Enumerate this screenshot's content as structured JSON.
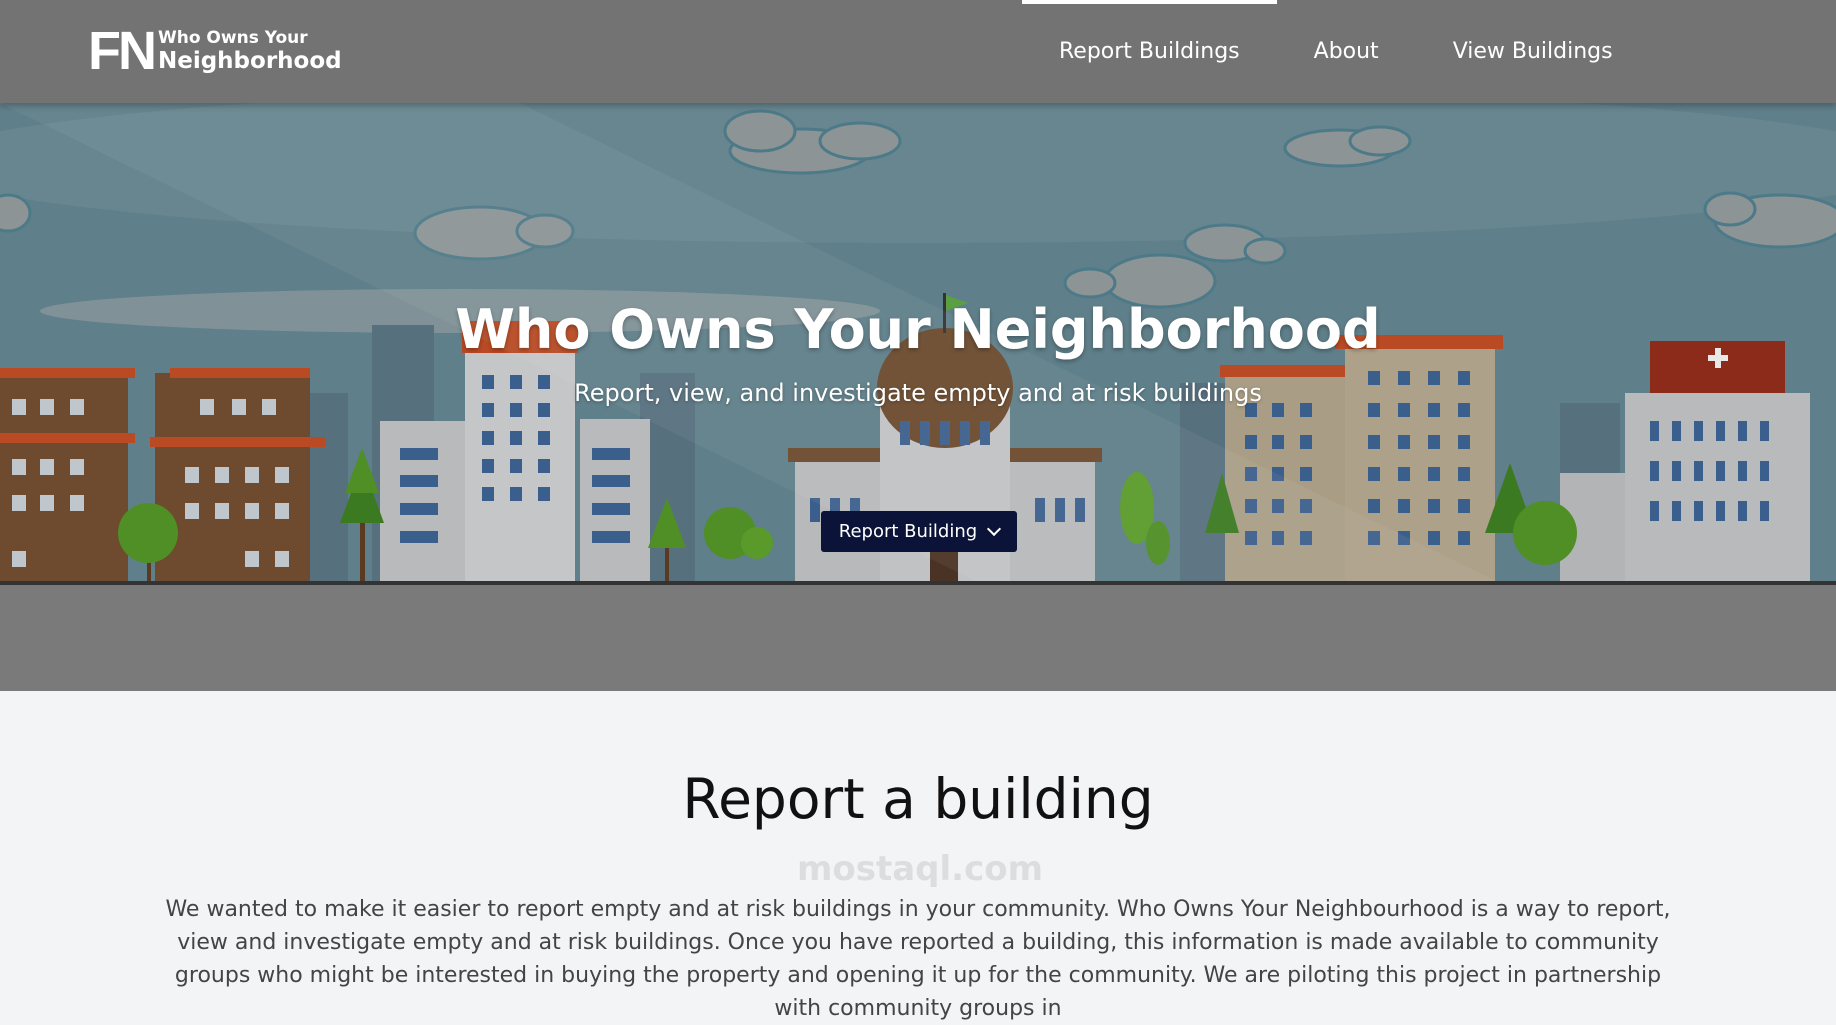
{
  "brand": {
    "mark": "FN",
    "line1": "Who Owns Your",
    "line2": "Neighborhood"
  },
  "nav": {
    "items": [
      {
        "label": "Report Buildings",
        "active": true
      },
      {
        "label": "About",
        "active": false
      },
      {
        "label": "View Buildings",
        "active": false
      }
    ]
  },
  "hero": {
    "title": "Who Owns Your Neighborhood",
    "subtitle": "Report, view, and investigate empty and at risk buildings",
    "button_label": "Report Building"
  },
  "section": {
    "title": "Report a building",
    "body": "We wanted to make it easier to report empty and at risk buildings in your community. Who Owns Your Neighbourhood is a way to report, view and investigate empty and at risk buildings. Once you have reported a building, this information is made available to community groups who might be interested in buying the property and opening it up for the community. We are piloting this project in partnership with community groups in"
  },
  "watermark": "mostaql.com",
  "colors": {
    "navbar": "#737373",
    "button": "#0b1438",
    "background": "#f3f4f6"
  }
}
